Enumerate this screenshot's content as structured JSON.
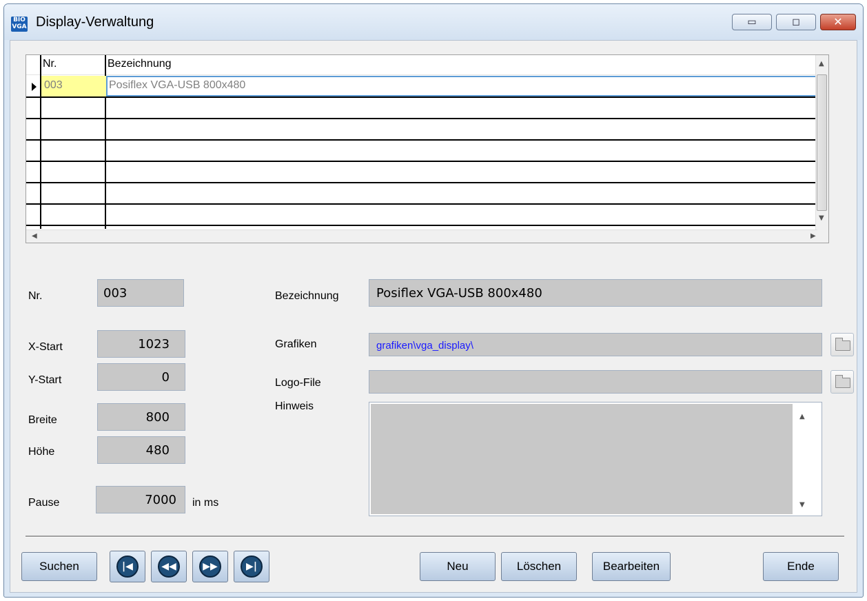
{
  "window": {
    "title": "Display-Verwaltung",
    "icon_text": [
      "BIO",
      "VGA"
    ],
    "controls": {
      "minimize": "▭",
      "maximize": "◻",
      "close": "✕"
    }
  },
  "grid": {
    "columns": [
      "Nr.",
      "Bezeichnung"
    ],
    "rows": [
      {
        "nr": "003",
        "bezeichnung": "Posiflex VGA-USB 800x480"
      }
    ]
  },
  "form": {
    "nr_label": "Nr.",
    "nr_value": "003",
    "bezeichnung_label": "Bezeichnung",
    "bezeichnung_value": "Posiflex VGA-USB 800x480",
    "xstart_label": "X-Start",
    "xstart_value": "1023",
    "ystart_label": "Y-Start",
    "ystart_value": "0",
    "breite_label": "Breite",
    "breite_value": "800",
    "hoehe_label": "Höhe",
    "hoehe_value": "480",
    "pause_label": "Pause",
    "pause_value": "7000",
    "pause_unit": "in ms",
    "grafiken_label": "Grafiken",
    "grafiken_value": "grafiken\\vga_display\\",
    "logo_label": "Logo-File",
    "logo_value": "",
    "hinweis_label": "Hinweis",
    "hinweis_value": ""
  },
  "buttons": {
    "suchen": "Suchen",
    "neu": "Neu",
    "loeschen": "Löschen",
    "bearbeiten": "Bearbeiten",
    "ende": "Ende"
  },
  "nav_icons": [
    "first-record-icon",
    "previous-record-icon",
    "next-record-icon",
    "last-record-icon"
  ],
  "colors": {
    "link_blue": "#1a1aff",
    "highlight_yellow": "#ffff99",
    "selection_border": "#5b9bd5"
  }
}
